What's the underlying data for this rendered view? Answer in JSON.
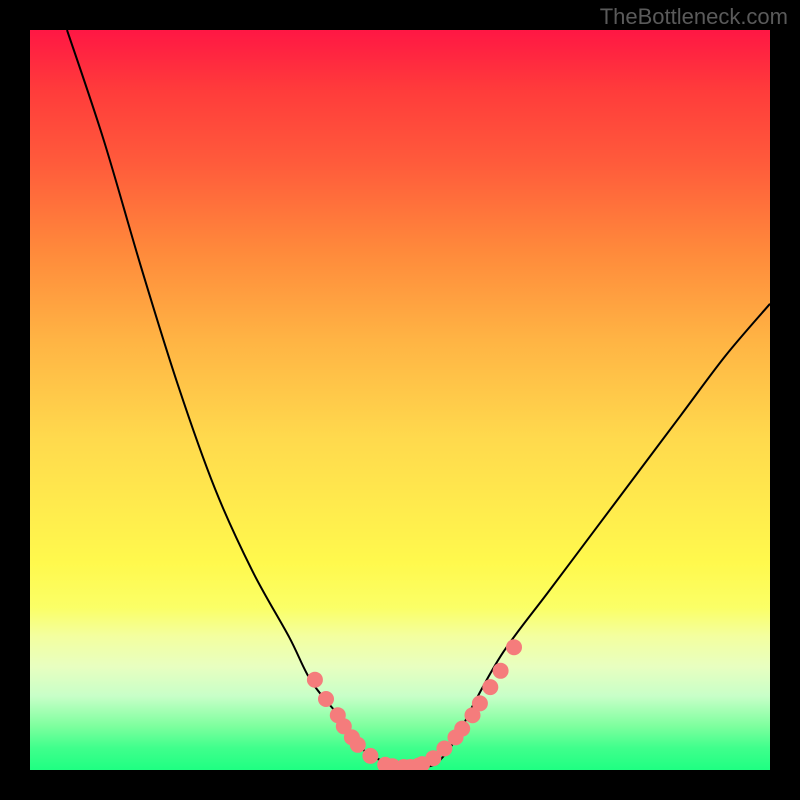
{
  "watermark": "TheBottleneck.com",
  "colors": {
    "curve_stroke": "#000000",
    "marker_fill": "#f57c7c",
    "background": "#000000"
  },
  "chart_data": {
    "type": "line",
    "title": "",
    "xlabel": "",
    "ylabel": "",
    "xlim": [
      0,
      100
    ],
    "ylim": [
      0,
      100
    ],
    "grid": false,
    "legend": false,
    "curve": {
      "description": "Asymmetric valley curve (bottleneck profile)",
      "x": [
        5,
        10,
        15,
        20,
        25,
        30,
        35,
        38,
        42,
        44,
        46,
        50,
        54,
        56,
        58,
        60,
        64,
        70,
        76,
        82,
        88,
        94,
        100
      ],
      "y": [
        100,
        85,
        68,
        52,
        38,
        27,
        18,
        12,
        7,
        4,
        2,
        0.5,
        0.5,
        2,
        5,
        9,
        16,
        24,
        32,
        40,
        48,
        56,
        63
      ]
    },
    "marker_clusters": [
      {
        "note": "Left descending segment markers",
        "x": [
          38.5,
          40.0,
          41.6,
          42.4,
          43.5,
          44.3,
          46.0
        ],
        "y": [
          12.2,
          9.6,
          7.4,
          5.9,
          4.4,
          3.4,
          1.9
        ]
      },
      {
        "note": "Valley floor markers",
        "x": [
          48.0,
          49.0,
          50.5,
          51.4,
          52.5,
          53.0,
          54.5,
          56.0
        ],
        "y": [
          0.7,
          0.5,
          0.4,
          0.4,
          0.6,
          0.8,
          1.6,
          2.9
        ]
      },
      {
        "note": "Right ascending segment markers",
        "x": [
          57.5,
          58.4,
          59.8,
          60.8,
          62.2,
          63.6,
          65.4
        ],
        "y": [
          4.4,
          5.6,
          7.4,
          9.0,
          11.2,
          13.4,
          16.6
        ]
      }
    ]
  }
}
